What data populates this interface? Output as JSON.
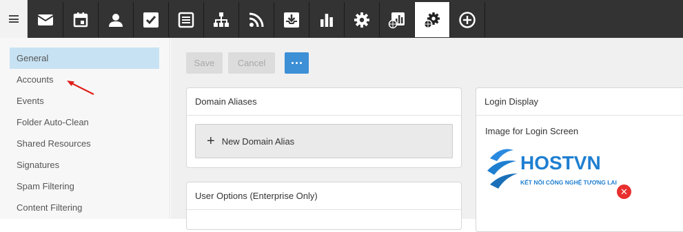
{
  "toolbar": {
    "icons": [
      "mail-icon",
      "calendar-icon",
      "contacts-icon",
      "tasks-icon",
      "notes-icon",
      "sitemap-icon",
      "rss-icon",
      "inbox-download-icon",
      "bar-chart-icon",
      "settings-icon",
      "domain-reports-icon",
      "domain-settings-icon",
      "add-circle-icon"
    ],
    "active": "domain-settings-icon"
  },
  "sidebar": {
    "items": [
      {
        "label": "General",
        "selected": true
      },
      {
        "label": "Accounts",
        "selected": false
      },
      {
        "label": "Events",
        "selected": false
      },
      {
        "label": "Folder Auto-Clean",
        "selected": false
      },
      {
        "label": "Shared Resources",
        "selected": false
      },
      {
        "label": "Signatures",
        "selected": false
      },
      {
        "label": "Spam Filtering",
        "selected": false
      },
      {
        "label": "Content Filtering",
        "selected": false
      }
    ]
  },
  "actions": {
    "save": "Save",
    "cancel": "Cancel"
  },
  "domain_aliases": {
    "title": "Domain Aliases",
    "new_alias": "New Domain Alias"
  },
  "user_options": {
    "title": "User Options (Enterprise Only)"
  },
  "login_display": {
    "title": "Login Display",
    "image_label": "Image for Login Screen",
    "logo_text": "HOSTVN",
    "logo_tagline": "KẾT NỐI CÔNG NGHỆ TƯƠNG LAI"
  },
  "colors": {
    "topbar": "#333333",
    "accent": "#3d8fd6",
    "selected": "#c7e2f3",
    "delete": "#e8302e",
    "logo_blue": "#1e7fd1"
  }
}
